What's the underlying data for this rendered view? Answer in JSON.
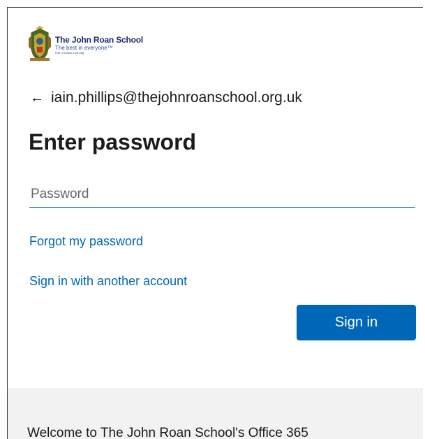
{
  "logo": {
    "name": "The John Roan School",
    "tagline": "The best in everyone™",
    "subtext": "Part of United Learning"
  },
  "identity": {
    "back_arrow": "←",
    "email": "iain.phillips@thejohnroanschool.org.uk"
  },
  "title": "Enter password",
  "password": {
    "placeholder": "Password",
    "value": ""
  },
  "links": {
    "forgot": "Forgot my password",
    "other_account": "Sign in with another account"
  },
  "signin_label": "Sign in",
  "footer": {
    "text": "Welcome to The John Roan School's Office 365"
  },
  "colors": {
    "accent": "#0067b8",
    "footer_bg": "#f2f2f2",
    "text": "#1b1b1b"
  }
}
